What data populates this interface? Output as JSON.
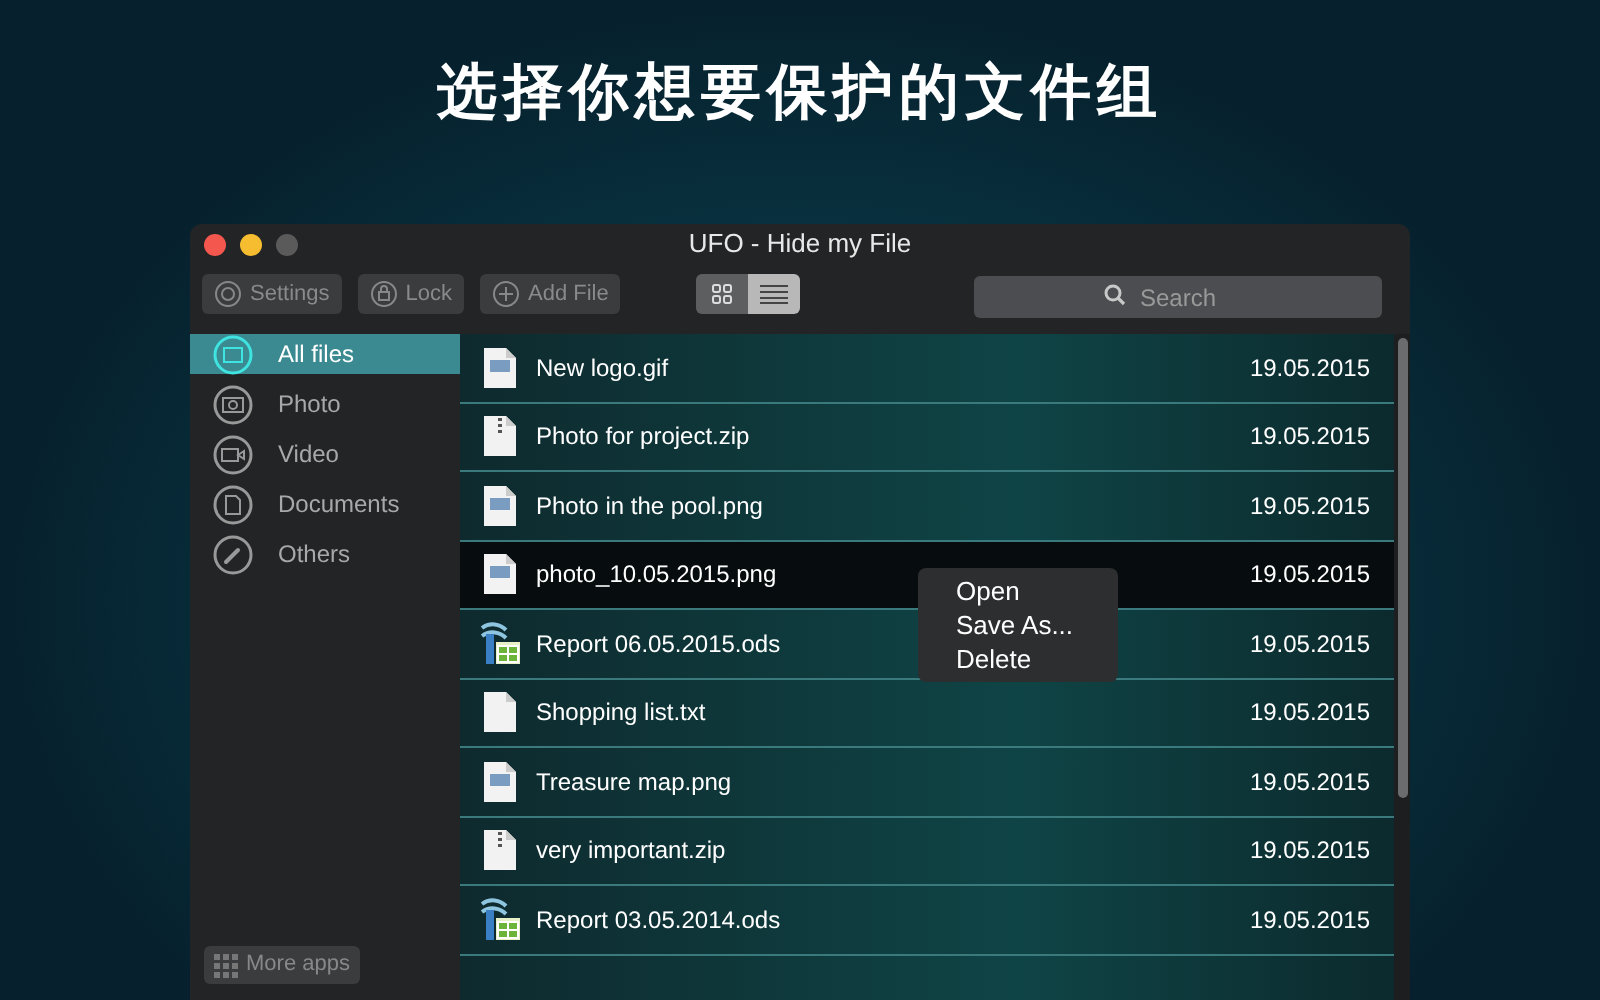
{
  "headline": "选择你想要保护的文件组",
  "window": {
    "title": "UFO - Hide my File"
  },
  "toolbar": {
    "buttons": [
      {
        "label": "Settings",
        "kind": "settings"
      },
      {
        "label": "Lock",
        "kind": "lock"
      },
      {
        "label": "Add File",
        "kind": "add"
      }
    ],
    "view_toggle": [
      {
        "kind": "grid",
        "selected": false
      },
      {
        "kind": "list",
        "selected": true
      }
    ],
    "search": {
      "placeholder": "Search"
    }
  },
  "sidebar": {
    "items": [
      {
        "label": "All files",
        "kind": "folder",
        "selected": true
      },
      {
        "label": "Photo",
        "kind": "photo",
        "selected": false
      },
      {
        "label": "Video",
        "kind": "video",
        "selected": false
      },
      {
        "label": "Documents",
        "kind": "document",
        "selected": false
      },
      {
        "label": "Others",
        "kind": "clip",
        "selected": false
      }
    ],
    "more_apps": "More apps"
  },
  "files": [
    {
      "name": "New logo.gif",
      "date": "19.05.2015",
      "kind": "gif",
      "selected": false
    },
    {
      "name": "Photo for project.zip",
      "date": "19.05.2015",
      "kind": "zip",
      "selected": false
    },
    {
      "name": "Photo in the pool.png",
      "date": "19.05.2015",
      "kind": "png",
      "selected": false
    },
    {
      "name": "photo_10.05.2015.png",
      "date": "19.05.2015",
      "kind": "png",
      "selected": true
    },
    {
      "name": "Report 06.05.2015.ods",
      "date": "19.05.2015",
      "kind": "ods",
      "selected": false
    },
    {
      "name": "Shopping list.txt",
      "date": "19.05.2015",
      "kind": "txt",
      "selected": false
    },
    {
      "name": "Treasure map.png",
      "date": "19.05.2015",
      "kind": "png",
      "selected": false
    },
    {
      "name": "very important.zip",
      "date": "19.05.2015",
      "kind": "zip",
      "selected": false
    },
    {
      "name": "Report 03.05.2014.ods",
      "date": "19.05.2015",
      "kind": "ods",
      "selected": false
    }
  ],
  "context_menu": [
    "Open",
    "Save As...",
    "Delete"
  ]
}
